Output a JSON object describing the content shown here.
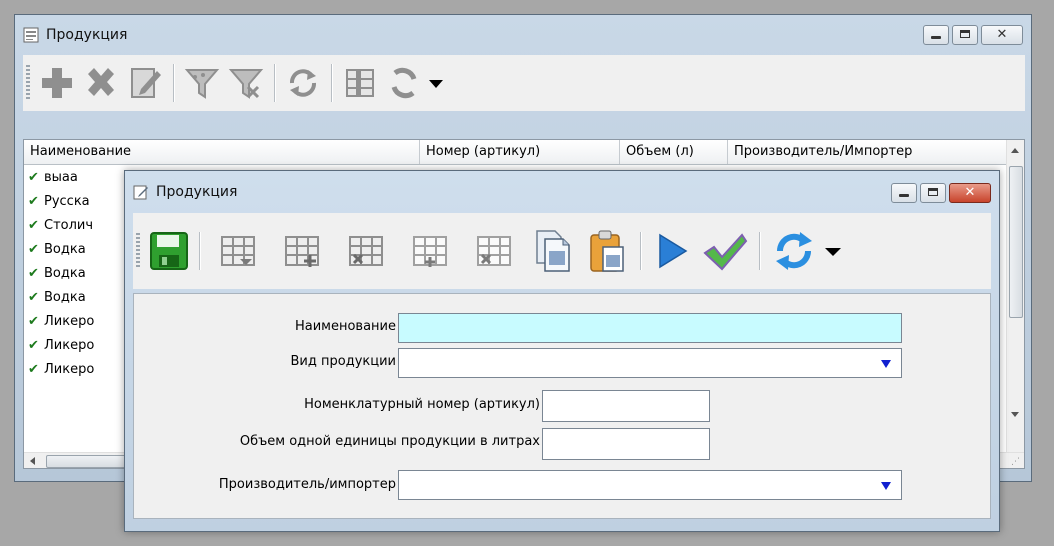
{
  "back_window": {
    "title": "Продукция",
    "columns": [
      "Наименование",
      "Номер (артикул)",
      "Объем (л)",
      "Производитель/Импортер"
    ],
    "rows": [
      "выаа",
      "Русска",
      "Столич",
      "Водка",
      "Водка",
      "Водка",
      "Ликеро",
      "Ликеро",
      "Ликеро"
    ],
    "icons": [
      "add-icon",
      "delete-icon",
      "edit-icon",
      "filter-icon",
      "clear-filter-icon",
      "refresh-icon",
      "columns-icon",
      "cycle-icon"
    ]
  },
  "front_window": {
    "title": "Продукция",
    "icons": [
      "save-icon",
      "grid-icon",
      "grid-icon",
      "grid-icon",
      "grid-icon",
      "grid-icon",
      "copy-icon",
      "paste-icon",
      "play-icon",
      "checkmark-icon",
      "refresh-icon"
    ],
    "form": {
      "name_label": "Наименование",
      "name_value": "",
      "type_label": "Вид продукции",
      "type_value": "",
      "article_label": "Номенклатурный номер (артикул)",
      "article_value": "",
      "volume_label": "Объем одной единицы продукции в литрах",
      "volume_value": "",
      "producer_label": "Производитель/импортер",
      "producer_value": ""
    }
  },
  "colors": {
    "window_frame": "#bfcfdf",
    "active_field": "#c8fbff",
    "dropdown_arrow": "#1020d0",
    "check_green": "#1d7a1d"
  }
}
